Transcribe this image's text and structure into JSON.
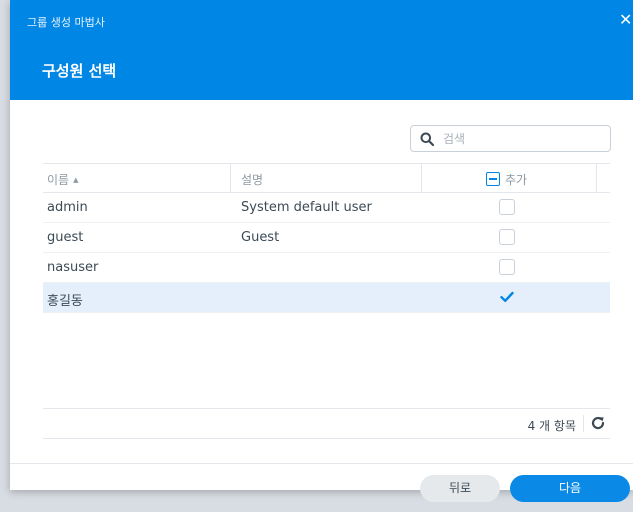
{
  "dialog": {
    "wizard_title": "그룹 생성 마법사",
    "close_symbol": "✕",
    "step_title": "구성원 선택"
  },
  "search": {
    "placeholder": "검색",
    "icon": "search-icon"
  },
  "table": {
    "columns": {
      "name": "이름",
      "description": "설명",
      "add": "추가"
    },
    "sort_indicator": "▲",
    "rows": [
      {
        "name": "admin",
        "description": "System default user",
        "added": false
      },
      {
        "name": "guest",
        "description": "Guest",
        "added": false
      },
      {
        "name": "nasuser",
        "description": "",
        "added": false
      },
      {
        "name": "홍길동",
        "description": "",
        "added": true
      }
    ]
  },
  "footer": {
    "count_text": "4 개 항목",
    "refresh_icon": "refresh-icon"
  },
  "buttons": {
    "back": "뒤로",
    "next": "다음"
  },
  "colors": {
    "accent": "#0086e5",
    "selected_row": "#e4effb"
  }
}
